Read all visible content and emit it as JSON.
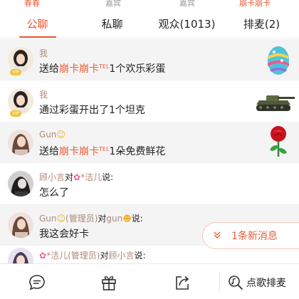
{
  "seats": [
    {
      "label": "春春",
      "highlight": true
    },
    {
      "label": "嘉宾",
      "highlight": false
    },
    {
      "label": "嘉宾",
      "highlight": false
    },
    {
      "label": "崩卡崩卡",
      "highlight": true
    }
  ],
  "tabs": [
    {
      "label": "公聊",
      "active": true
    },
    {
      "label": "私聊",
      "active": false
    },
    {
      "label": "观众(1013)",
      "active": false
    },
    {
      "label": "排麦(2)",
      "active": false
    }
  ],
  "messages": [
    {
      "user": "我",
      "vip_badge": "VIP",
      "prefix": "送给",
      "target": "崩卡崩卡",
      "target_sup": "TEL",
      "suffix": "1个欢乐彩蛋",
      "gift_icon": "easter-egg-icon"
    },
    {
      "user": "我",
      "vip_badge": "VIP",
      "text": "通过彩蛋开出了1个坦克",
      "gift_icon": "tank-icon"
    },
    {
      "user": "Gun",
      "prefix": "送给",
      "target": "崩卡崩卡",
      "target_sup": "TEL",
      "suffix": "1朵免费鲜花",
      "gift_icon": "rose-icon"
    },
    {
      "user": "顾小言",
      "connector": "对",
      "to_user": "*洁儿",
      "say": "说:",
      "text": "怎么了"
    },
    {
      "user": "Gun",
      "role": "(管理员)",
      "connector": "对",
      "to_user": "gun",
      "say": "说:",
      "text": "我这会好卡"
    },
    {
      "user": "*洁儿",
      "role": "(管理员)",
      "connector": "对",
      "to_user": "顾小言",
      "say": "说:"
    }
  ],
  "new_message_pill": {
    "label": "1条新消息",
    "icon": "chevron-double-down-icon"
  },
  "bottom_bar": {
    "icons": [
      "chat-icon",
      "gift-icon",
      "share-icon"
    ],
    "order_song": {
      "label": "点歌排麦",
      "icon": "music-search-icon"
    }
  },
  "colors": {
    "accent": "#ee5533",
    "nick": "#e8613c",
    "username": "#b08a78",
    "shaded_row": "#f4f4f4"
  }
}
